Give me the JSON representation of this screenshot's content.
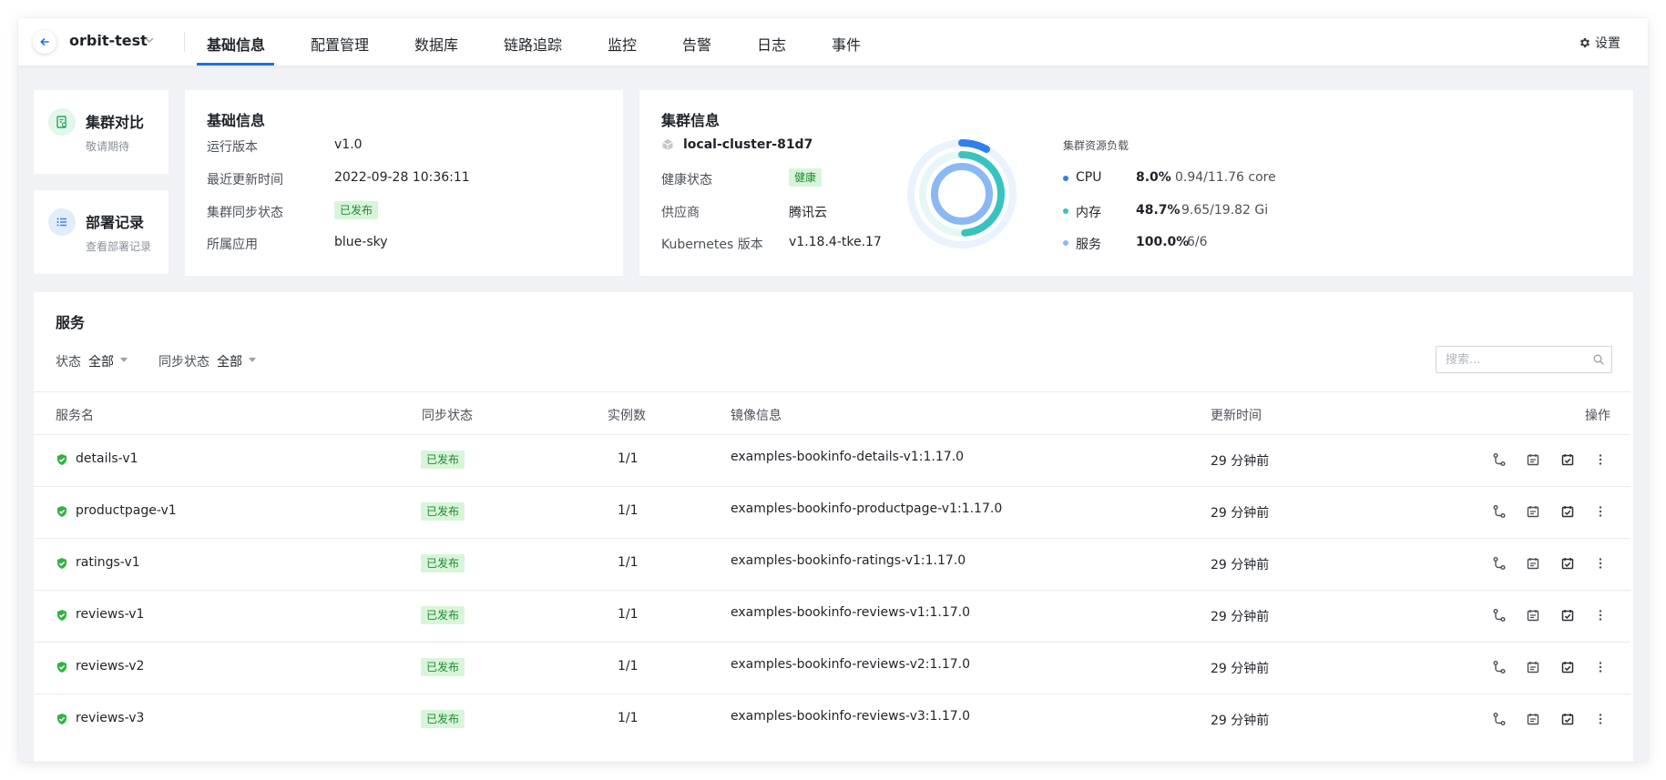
{
  "header": {
    "app_name": "orbit-test",
    "tabs": [
      {
        "label": "基础信息",
        "active": true
      },
      {
        "label": "配置管理"
      },
      {
        "label": "数据库"
      },
      {
        "label": "链路追踪"
      },
      {
        "label": "监控"
      },
      {
        "label": "告警"
      },
      {
        "label": "日志"
      },
      {
        "label": "事件"
      }
    ],
    "settings_label": "设置",
    "accent_color": "#1d6fe5"
  },
  "side_cards": {
    "compare": {
      "title": "集群对比",
      "subtitle": "敬请期待",
      "icon": "compare-doc-icon"
    },
    "deploy": {
      "title": "部署记录",
      "subtitle": "查看部署记录",
      "icon": "list-icon"
    }
  },
  "basic_info": {
    "title": "基础信息",
    "rows": [
      {
        "label": "运行版本",
        "value": "v1.0"
      },
      {
        "label": "最近更新时间",
        "value": "2022-09-28 10:36:11"
      },
      {
        "label": "集群同步状态",
        "value": "已发布"
      },
      {
        "label": "所属应用",
        "value": "blue-sky"
      }
    ]
  },
  "cluster_info": {
    "title": "集群信息",
    "cluster_name": "local-cluster-81d7",
    "rows": [
      {
        "label": "健康状态",
        "value": "健康"
      },
      {
        "label": "供应商",
        "value": "腾讯云"
      },
      {
        "label": "Kubernetes 版本",
        "value": "v1.18.4-tke.17"
      }
    ],
    "load_title": "集群资源负载",
    "load": [
      {
        "name": "CPU",
        "pct_text": "8.0%",
        "detail": "0.94/11.76 core",
        "fraction": 0.08,
        "color": "#2f7ff0"
      },
      {
        "name": "内存",
        "pct_text": "48.7%",
        "detail": "9.65/19.82 Gi",
        "fraction": 0.487,
        "color": "#39c3c0"
      },
      {
        "name": "服务",
        "pct_text": "100.0%",
        "detail": "6/6",
        "fraction": 1.0,
        "color": "#8ab8f5"
      }
    ]
  },
  "services": {
    "title": "服务",
    "filters": [
      {
        "label": "状态",
        "value": "全部"
      },
      {
        "label": "同步状态",
        "value": "全部"
      }
    ],
    "search_placeholder": "搜索...",
    "columns": [
      "服务名",
      "同步状态",
      "实例数",
      "镜像信息",
      "更新时间",
      "操作"
    ],
    "rows": [
      {
        "name": "details-v1",
        "sync": "已发布",
        "instances": "1/1",
        "image": "examples-bookinfo-details-v1:1.17.0",
        "updated": "29 分钟前"
      },
      {
        "name": "productpage-v1",
        "sync": "已发布",
        "instances": "1/1",
        "image": "examples-bookinfo-productpage-v1:1.17.0",
        "updated": "29 分钟前"
      },
      {
        "name": "ratings-v1",
        "sync": "已发布",
        "instances": "1/1",
        "image": "examples-bookinfo-ratings-v1:1.17.0",
        "updated": "29 分钟前"
      },
      {
        "name": "reviews-v1",
        "sync": "已发布",
        "instances": "1/1",
        "image": "examples-bookinfo-reviews-v1:1.17.0",
        "updated": "29 分钟前"
      },
      {
        "name": "reviews-v2",
        "sync": "已发布",
        "instances": "1/1",
        "image": "examples-bookinfo-reviews-v2:1.17.0",
        "updated": "29 分钟前"
      },
      {
        "name": "reviews-v3",
        "sync": "已发布",
        "instances": "1/1",
        "image": "examples-bookinfo-reviews-v3:1.17.0",
        "updated": "29 分钟前"
      }
    ],
    "row_actions": [
      "route-icon",
      "calendar-icon",
      "calendar-check-icon",
      "more-vertical-icon"
    ],
    "healthy_color": "#2fb344"
  }
}
